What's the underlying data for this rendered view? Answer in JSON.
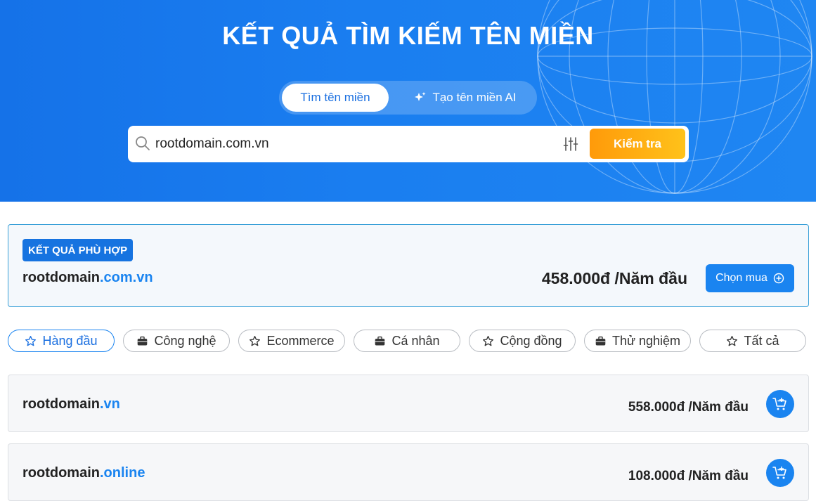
{
  "hero": {
    "title": "KẾT QUẢ TÌM KIẾM TÊN MIỀN",
    "tabs": [
      {
        "label": "Tìm tên miền",
        "active": true
      },
      {
        "label": "Tạo tên miền AI",
        "icon": "sparkle-icon",
        "active": false
      }
    ],
    "search": {
      "value": "rootdomain.com.vn",
      "button_label": "Kiểm tra"
    }
  },
  "match": {
    "badge": "KẾT QUẢ PHÙ HỢP",
    "domain_name": "rootdomain",
    "domain_tld": ".com.vn",
    "price": "458.000đ /Năm đầu",
    "buy_label": "Chọn mua"
  },
  "categories": [
    {
      "label": "Hàng đầu",
      "icon": "star-icon",
      "active": true
    },
    {
      "label": "Công nghệ",
      "icon": "briefcase-icon",
      "active": false
    },
    {
      "label": "Ecommerce",
      "icon": "star-icon",
      "active": false
    },
    {
      "label": "Cá nhân",
      "icon": "briefcase-icon",
      "active": false
    },
    {
      "label": "Cộng đồng",
      "icon": "star-icon",
      "active": false
    },
    {
      "label": "Thử nghiệm",
      "icon": "briefcase-icon",
      "active": false
    },
    {
      "label": "Tất cả",
      "icon": "star-icon",
      "active": false
    }
  ],
  "results": [
    {
      "domain_name": "rootdomain",
      "domain_tld": ".vn",
      "price": "558.000đ /Năm đầu"
    },
    {
      "domain_name": "rootdomain",
      "domain_tld": ".online",
      "price": "108.000đ /Năm đầu"
    }
  ],
  "colors": {
    "primary": "#1a84f0",
    "accent": "#ffb010",
    "hero": "#1572e8"
  }
}
